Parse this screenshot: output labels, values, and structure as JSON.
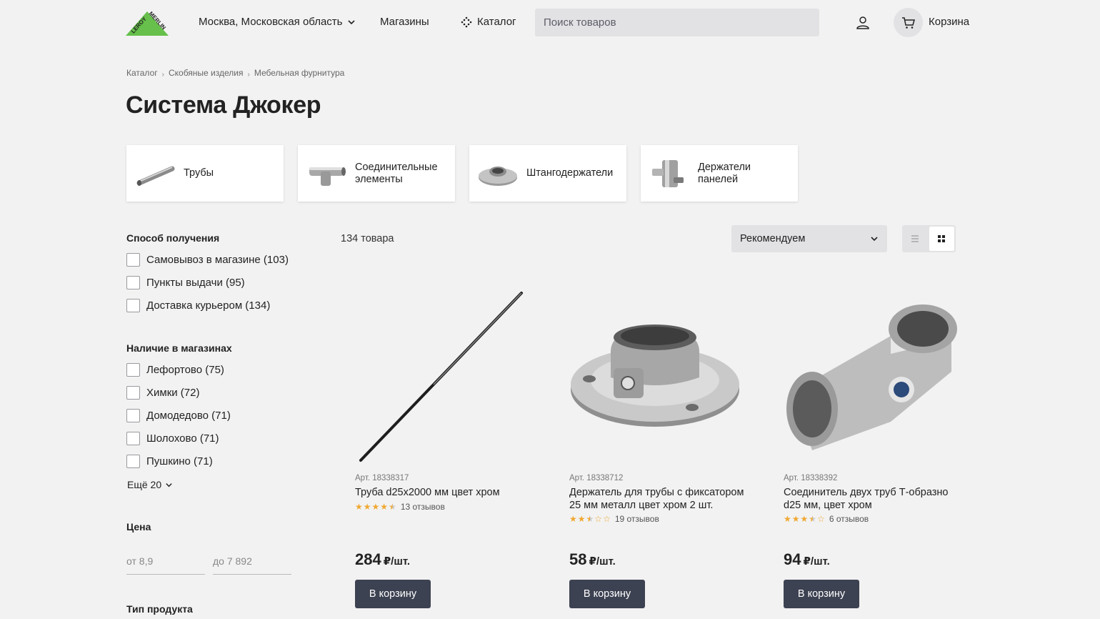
{
  "header": {
    "region": "Москва, Московская область",
    "stores": "Магазины",
    "catalog": "Каталог",
    "search_placeholder": "Поиск товаров",
    "cart": "Корзина",
    "logo_text": "LEROY MERLIN"
  },
  "breadcrumb": [
    "Каталог",
    "Скобяные изделия",
    "Мебельная фурнитура"
  ],
  "page_title": "Система Джокер",
  "categories": [
    {
      "label": "Трубы",
      "icon": "pipe-icon"
    },
    {
      "label": "Соединительные элементы",
      "icon": "connector-icon"
    },
    {
      "label": "Штангодержатели",
      "icon": "rod-holder-icon"
    },
    {
      "label": "Держатели панелей",
      "icon": "panel-holder-icon"
    }
  ],
  "filters": {
    "delivery": {
      "title": "Способ получения",
      "options": [
        "Самовывоз в магазине (103)",
        "Пункты выдачи (95)",
        "Доставка курьером (134)"
      ]
    },
    "stores": {
      "title": "Наличие в магазинах",
      "options": [
        "Лефортово (75)",
        "Химки (72)",
        "Домодедово (71)",
        "Шолохово (71)",
        "Пушкино (71)"
      ],
      "more": "Ещё 20"
    },
    "price": {
      "title": "Цена",
      "from_placeholder": "от 8,9",
      "to_placeholder": "до 7 892"
    },
    "product_type": {
      "title": "Тип продукта"
    }
  },
  "results": {
    "count": "134 товара",
    "sort": "Рекомендуем"
  },
  "products": [
    {
      "art": "Арт. 18338317",
      "name": "Труба d25x2000 мм цвет хром",
      "rating": 4.5,
      "reviews": "13 отзывов",
      "price": "284",
      "unit": "₽/шт.",
      "button": "В корзину"
    },
    {
      "art": "Арт. 18338712",
      "name": "Держатель для трубы с фиксатором 25 мм металл цвет хром 2 шт.",
      "rating": 2.5,
      "reviews": "19 отзывов",
      "price": "58",
      "unit": "₽/шт.",
      "button": "В корзину"
    },
    {
      "art": "Арт. 18338392",
      "name": "Соединитель двух труб Т-образно d25 мм, цвет хром",
      "rating": 3.5,
      "reviews": "6 отзывов",
      "price": "94",
      "unit": "₽/шт.",
      "button": "В корзину"
    }
  ],
  "colors": {
    "brand_green": "#66c04b",
    "button_dark": "#3d4252",
    "star": "#f0a830"
  }
}
